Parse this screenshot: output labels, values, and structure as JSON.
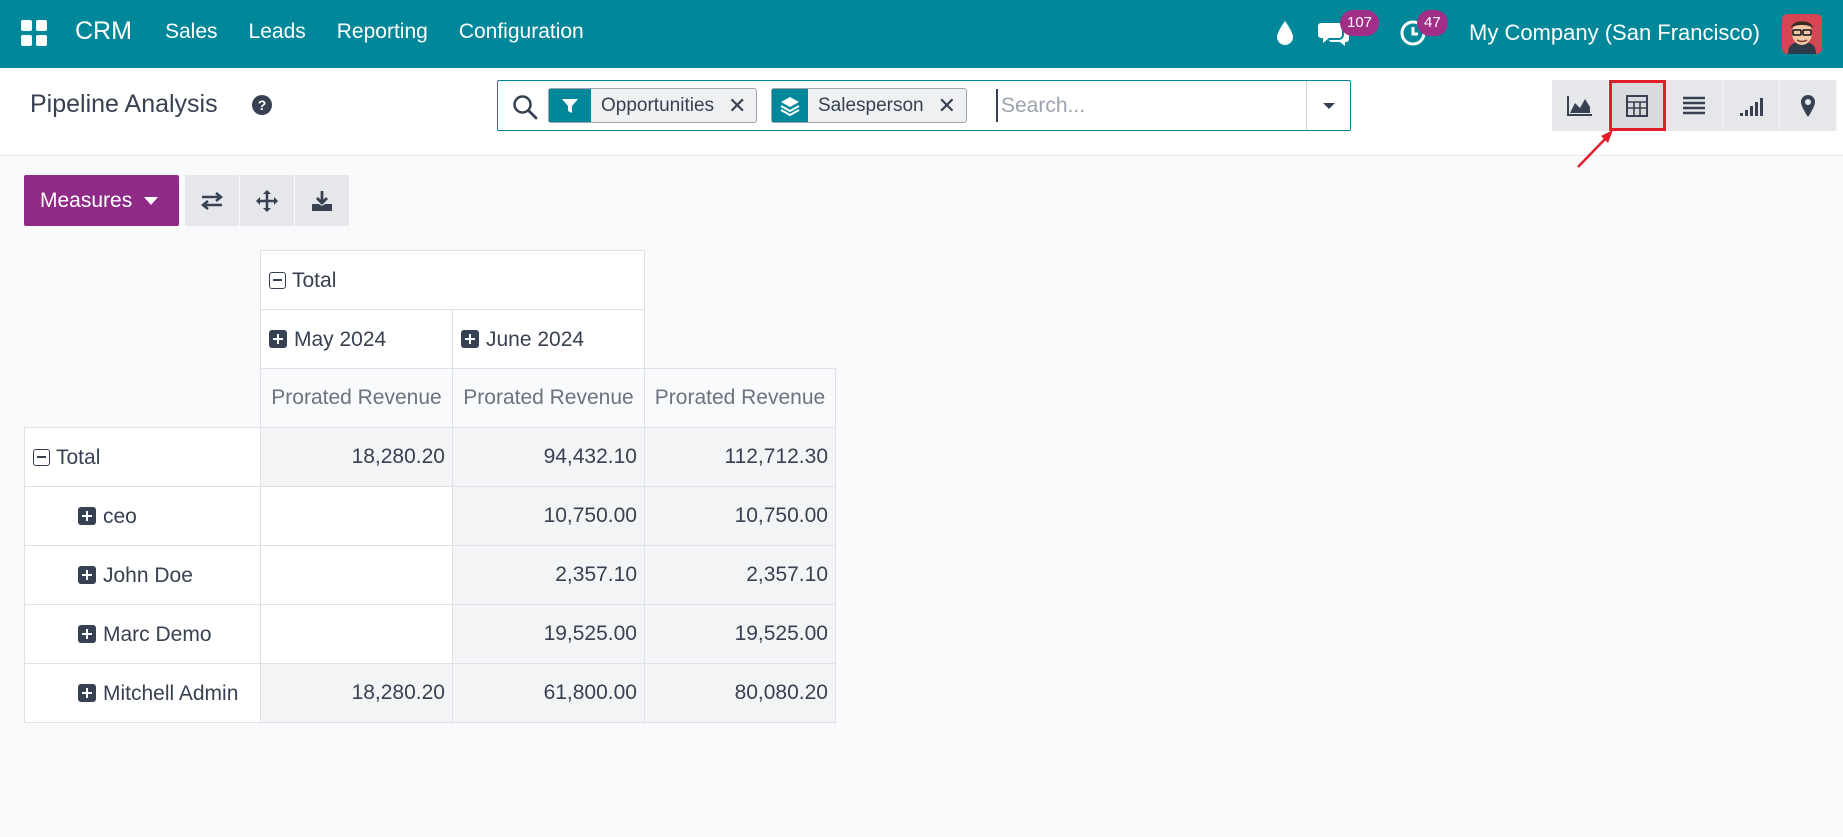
{
  "navbar": {
    "app_name": "CRM",
    "menu": [
      "Sales",
      "Leads",
      "Reporting",
      "Configuration"
    ],
    "messages_count": "107",
    "activities_count": "47",
    "company": "My Company (San Francisco)"
  },
  "control_panel": {
    "title": "Pipeline Analysis",
    "help": "?",
    "facets": [
      {
        "label": "Opportunities",
        "icon": "filter-icon"
      },
      {
        "label": "Salesperson",
        "icon": "group-by-layers-icon"
      }
    ],
    "search_placeholder": "Search...",
    "views": [
      "graph-icon",
      "pivot-icon",
      "list-icon",
      "cohort-icon",
      "map-icon"
    ],
    "active_view": "pivot-icon"
  },
  "toolbar": {
    "measures_label": "Measures"
  },
  "pivot": {
    "col_total_header": "Total",
    "col_groups": [
      "May 2024",
      "June 2024"
    ],
    "measure_label": "Prorated Revenue",
    "row_total_label": "Total",
    "total_row": [
      "18,280.20",
      "94,432.10",
      "112,712.30"
    ],
    "rows": [
      {
        "label": "ceo",
        "values": [
          "",
          "10,750.00",
          "10,750.00"
        ]
      },
      {
        "label": "John Doe",
        "values": [
          "",
          "2,357.10",
          "2,357.10"
        ]
      },
      {
        "label": "Marc Demo",
        "values": [
          "",
          "19,525.00",
          "19,525.00"
        ]
      },
      {
        "label": "Mitchell Admin",
        "values": [
          "18,280.20",
          "61,800.00",
          "80,080.20"
        ]
      }
    ]
  },
  "colors": {
    "navbar": "#00889a",
    "primary": "#8f2b87",
    "badge": "#a12e87",
    "highlight": "#e11d2a"
  }
}
